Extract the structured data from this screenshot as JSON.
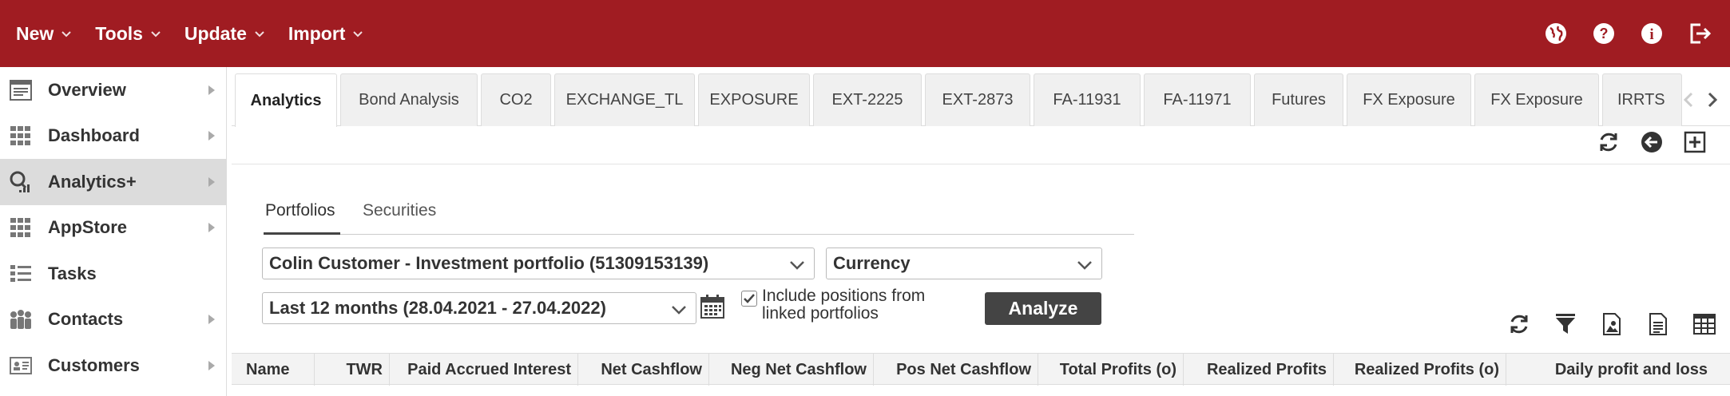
{
  "topmenu": [
    {
      "label": "New"
    },
    {
      "label": "Tools"
    },
    {
      "label": "Update"
    },
    {
      "label": "Import"
    }
  ],
  "topicons": [
    "globe-icon",
    "help-icon",
    "info-icon",
    "logout-icon"
  ],
  "sidebar": {
    "items": [
      {
        "label": "Overview",
        "icon": "overview-icon",
        "active": false
      },
      {
        "label": "Dashboard",
        "icon": "dashboard-icon",
        "active": false
      },
      {
        "label": "Analytics+",
        "icon": "analytics-icon",
        "active": true
      },
      {
        "label": "AppStore",
        "icon": "appstore-icon",
        "active": false
      },
      {
        "label": "Tasks",
        "icon": "tasks-icon",
        "active": false
      },
      {
        "label": "Contacts",
        "icon": "contacts-icon",
        "active": false
      },
      {
        "label": "Customers",
        "icon": "customers-icon",
        "active": false
      }
    ]
  },
  "tabs": [
    {
      "label": "Analytics",
      "active": true
    },
    {
      "label": "Bond Analysis"
    },
    {
      "label": "CO2"
    },
    {
      "label": "EXCHANGE_TL"
    },
    {
      "label": "EXPOSURE"
    },
    {
      "label": "EXT-2225"
    },
    {
      "label": "EXT-2873"
    },
    {
      "label": "FA-11931"
    },
    {
      "label": "FA-11971"
    },
    {
      "label": "Futures"
    },
    {
      "label": "FX Exposure"
    },
    {
      "label": "FX Exposure"
    },
    {
      "label": "IRRTS"
    }
  ],
  "subtabs": [
    {
      "label": "Portfolios",
      "active": true
    },
    {
      "label": "Securities"
    }
  ],
  "form": {
    "portfolio": "Colin Customer - Investment portfolio (51309153139)",
    "currency": "Currency",
    "period": "Last 12 months (28.04.2021 - 27.04.2022)",
    "include_linked": "Include positions from linked portfolios",
    "include_linked_checked": true,
    "analyze_label": "Analyze"
  },
  "table": {
    "columns": [
      "Name",
      "TWR",
      "Paid Accrued Interest",
      "Net Cashflow",
      "Neg Net Cashflow",
      "Pos Net Cashflow",
      "Total Profits (o)",
      "Realized Profits",
      "Realized Profits (o)",
      "Daily profit and loss"
    ]
  },
  "colors": {
    "brand": "#a01c22",
    "button": "#444444"
  }
}
